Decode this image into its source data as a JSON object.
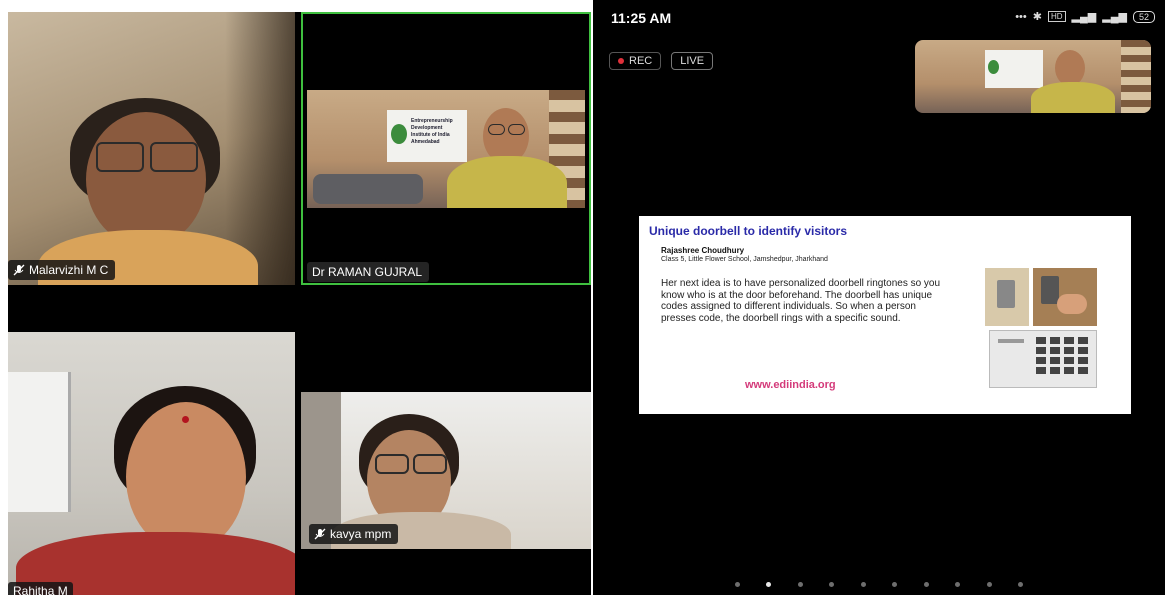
{
  "left_gallery": {
    "participants": [
      {
        "name": "Malarvizhi M C"
      },
      {
        "name": "Dr RAMAN GUJRAL"
      },
      {
        "name": "kavya mpm"
      },
      {
        "name": "Rahitha M"
      }
    ],
    "active_speaker_border": "#3fbf3f"
  },
  "phone_view": {
    "status_time": "11:25 AM",
    "rec_label": "REC",
    "live_label": "LIVE",
    "battery": "52",
    "backdrop_text": [
      "Entrepreneurship",
      "Development",
      "Institute of India",
      "Ahmedabad"
    ],
    "slide": {
      "title": "Unique doorbell to identify visitors",
      "author": "Rajashree Choudhury",
      "school": "Class 5, Little Flower School, Jamshedpur, Jharkhand",
      "body": "Her next idea is to have personalized doorbell ringtones so you know who is at the door beforehand. The doorbell has unique codes assigned to different individuals. So when a person presses code, the doorbell rings with a specific sound.",
      "url": "www.ediindia.org"
    },
    "page_dots": {
      "count": 10,
      "active_index": 1
    }
  },
  "colors": {
    "slide_title": "#2a2aa8",
    "slide_url": "#d43a7a",
    "rec_dot": "#e0303a"
  }
}
